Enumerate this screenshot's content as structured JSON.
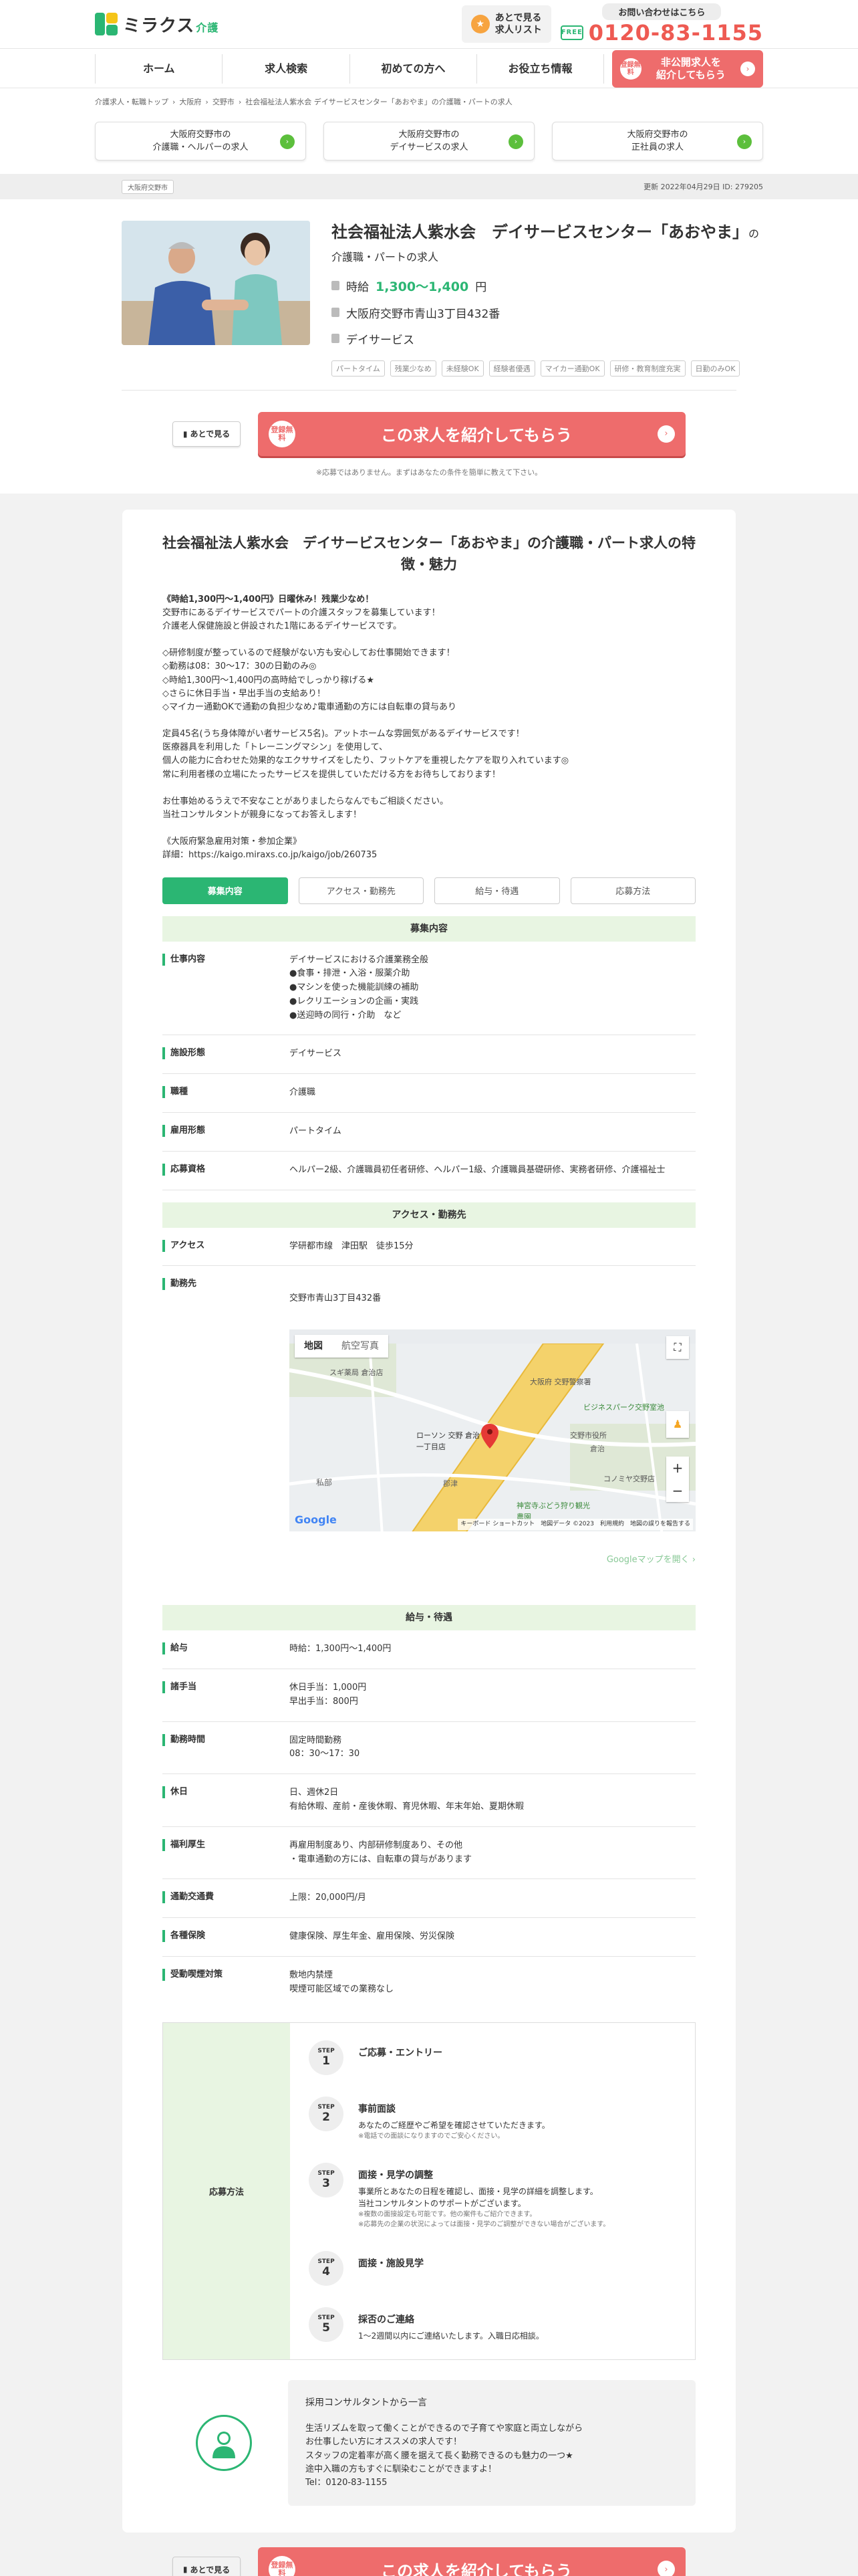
{
  "header": {
    "logo_text": "ミラクス",
    "logo_sub": "介護",
    "saved_list": "あとで見る\n求人リスト",
    "contact_label": "お問い合わせはこちら",
    "tel": "0120-83-1155",
    "free_dial": "FREE"
  },
  "nav": {
    "items": [
      "ホーム",
      "求人検索",
      "初めての方へ",
      "お役立ち情報"
    ],
    "cta_badge": "登録無料",
    "cta_text": "非公開求人を\n紹介してもらう"
  },
  "breadcrumb": [
    "介護求人・転職トップ",
    "大阪府",
    "交野市",
    "社会福祉法人紫水会 デイサービスセンター「あおやま」の介護職・パートの求人"
  ],
  "related": [
    "大阪府交野市の\n介護職・ヘルパーの求人",
    "大阪府交野市の\nデイサービスの求人",
    "大阪府交野市の\n正社員の求人"
  ],
  "meta": {
    "pr_tag": "大阪府交野市",
    "update": "更新 2022年04月29日 ID: 279205"
  },
  "job": {
    "title": "社会福祉法人紫水会　デイサービスセンター「あおやま」",
    "title_suffix": "の介護職・パートの求人",
    "wage_prefix": "時給",
    "wage": "1,300〜1,400",
    "wage_unit": "円",
    "address": "大阪府交野市青山3丁目432番",
    "facility": "デイサービス",
    "tags": [
      "パートタイム",
      "残業少なめ",
      "未経験OK",
      "経験者優遇",
      "マイカー通勤OK",
      "研修・教育制度充実",
      "日勤のみOK"
    ]
  },
  "cta": {
    "later": "あとで見る",
    "badge": "登録無料",
    "main": "この求人を紹介してもらう",
    "note": "※応募ではありません。まずはあなたの条件を簡単に教えて下さい。"
  },
  "detail": {
    "heading": "社会福祉法人紫水会　デイサービスセンター「あおやま」の介護職・パート求人の特徴・魅力",
    "lead": "《時給1,300円〜1,400円》日曜休み！残業少なめ！",
    "body": "交野市にあるデイサービスでパートの介護スタッフを募集しています！\n介護老人保健施設と併設された1階にあるデイサービスです。\n\n◇研修制度が整っているので経験がない方も安心してお仕事開始できます！\n◇勤務は08：30〜17：30の日勤のみ◎\n◇時給1,300円〜1,400円の高時給でしっかり稼げる★\n◇さらに休日手当・早出手当の支給あり！\n◇マイカー通勤OKで通勤の負担少なめ♪電車通勤の方には自転車の貸与あり\n\n定員45名(うち身体障がい者サービス5名)。アットホームな雰囲気があるデイサービスです！\n医療器具を利用した「トレーニングマシン」を使用して、\n個人の能力に合わせた効果的なエクササイズをしたり、フットケアを重視したケアを取り入れています◎\n常に利用者様の立場にたったサービスを提供していただける方をお待ちしております！\n\nお仕事始めるうえで不安なことがありましたらなんでもご相談ください。\n当社コンサルタントが親身になってお答えします！\n\n《大阪府緊急雇用対策・参加企業》\n詳細：https://kaigo.miraxs.co.jp/kaigo/job/260735",
    "tabs": [
      "募集内容",
      "アクセス・勤務先",
      "給与・待遇",
      "応募方法"
    ],
    "sec1": "募集内容",
    "rows1": [
      {
        "th": "仕事内容",
        "td": "デイサービスにおける介護業務全般\n●食事・排泄・入浴・服薬介助\n●マシンを使った機能訓練の補助\n●レクリエーションの企画・実践\n●送迎時の同行・介助　など"
      },
      {
        "th": "施設形態",
        "td": "デイサービス"
      },
      {
        "th": "職種",
        "td": "介護職"
      },
      {
        "th": "雇用形態",
        "td": "パートタイム"
      },
      {
        "th": "応募資格",
        "td": "ヘルパー2級、介護職員初任者研修、ヘルパー1級、介護職員基礎研修、実務者研修、介護福祉士"
      }
    ],
    "sec2": "アクセス・勤務先",
    "access_th": "アクセス",
    "access_td": "学研都市線　津田駅　徒歩15分",
    "workplace_th": "勤務先",
    "workplace_td": "交野市青山3丁目432番",
    "map": {
      "tab_map": "地図",
      "tab_photo": "航空写真",
      "google": "Google",
      "attribution": "キーボード ショートカット　地図データ ©2023　利用規約　地図の誤りを報告する",
      "labels": [
        "大阪府 交野警察署",
        "ローソン 交野 倉治一丁目店",
        "ビジネスパーク交野室池",
        "私部",
        "倉治",
        "郡津",
        "神宮寺ぶどう狩り観光農園",
        "交野市役所",
        "スギ薬局 倉治店",
        "コノミヤ交野店"
      ],
      "link": "Googleマップを開く"
    },
    "sec3": "給与・待遇",
    "rows3": [
      {
        "th": "給与",
        "td": "時給：1,300円〜1,400円"
      },
      {
        "th": "諸手当",
        "td": "休日手当：1,000円\n早出手当：800円"
      },
      {
        "th": "勤務時間",
        "td": "固定時間勤務\n08：30〜17：30"
      },
      {
        "th": "休日",
        "td": "日、週休2日\n有給休暇、産前・産後休暇、育児休暇、年末年始、夏期休暇"
      },
      {
        "th": "福利厚生",
        "td": "再雇用制度あり、内部研修制度あり、その他\n・電車通勤の方には、自転車の貸与があります"
      },
      {
        "th": "通勤交通費",
        "td": "上限：20,000円/月"
      },
      {
        "th": "各種保険",
        "td": "健康保険、厚生年金、雇用保険、労災保険"
      },
      {
        "th": "受動喫煙対策",
        "td": "敷地内禁煙\n喫煙可能区域での業務なし"
      }
    ],
    "apply_th": "応募方法",
    "step_label": "STEP",
    "steps": [
      {
        "n": "1",
        "title": "ご応募・エントリー",
        "text": "",
        "note": ""
      },
      {
        "n": "2",
        "title": "事前面談",
        "text": "あなたのご経歴やご希望を確認させていただきます。",
        "note": "※電話での面談になりますのでご安心ください。"
      },
      {
        "n": "3",
        "title": "面接・見学の調整",
        "text": "事業所とあなたの日程を確認し、面接・見学の詳細を調整します。\n当社コンサルタントのサポートがございます。",
        "note": "※複数の面接設定も可能です。他の案件もご紹介できます。\n※応募先の企業の状況によっては面接・見学のご調整ができない場合がございます。"
      },
      {
        "n": "4",
        "title": "面接・施設見学",
        "text": "",
        "note": ""
      },
      {
        "n": "5",
        "title": "採否のご連絡",
        "text": "1〜2週間以内にご連絡いたします。入職日応相談。",
        "note": ""
      }
    ],
    "consult_title": "採用コンサルタントから一言",
    "consult_text": "生活リズムを取って働くことができるので子育てや家庭と両立しながら\nお仕事したい方にオススメの求人です！\nスタッフの定着率が高く腰を据えて長く勤務できるのも魅力の一つ★\n途中入職の方もすぐに馴染むことができますよ！\nTel：0120-83-1155"
  }
}
